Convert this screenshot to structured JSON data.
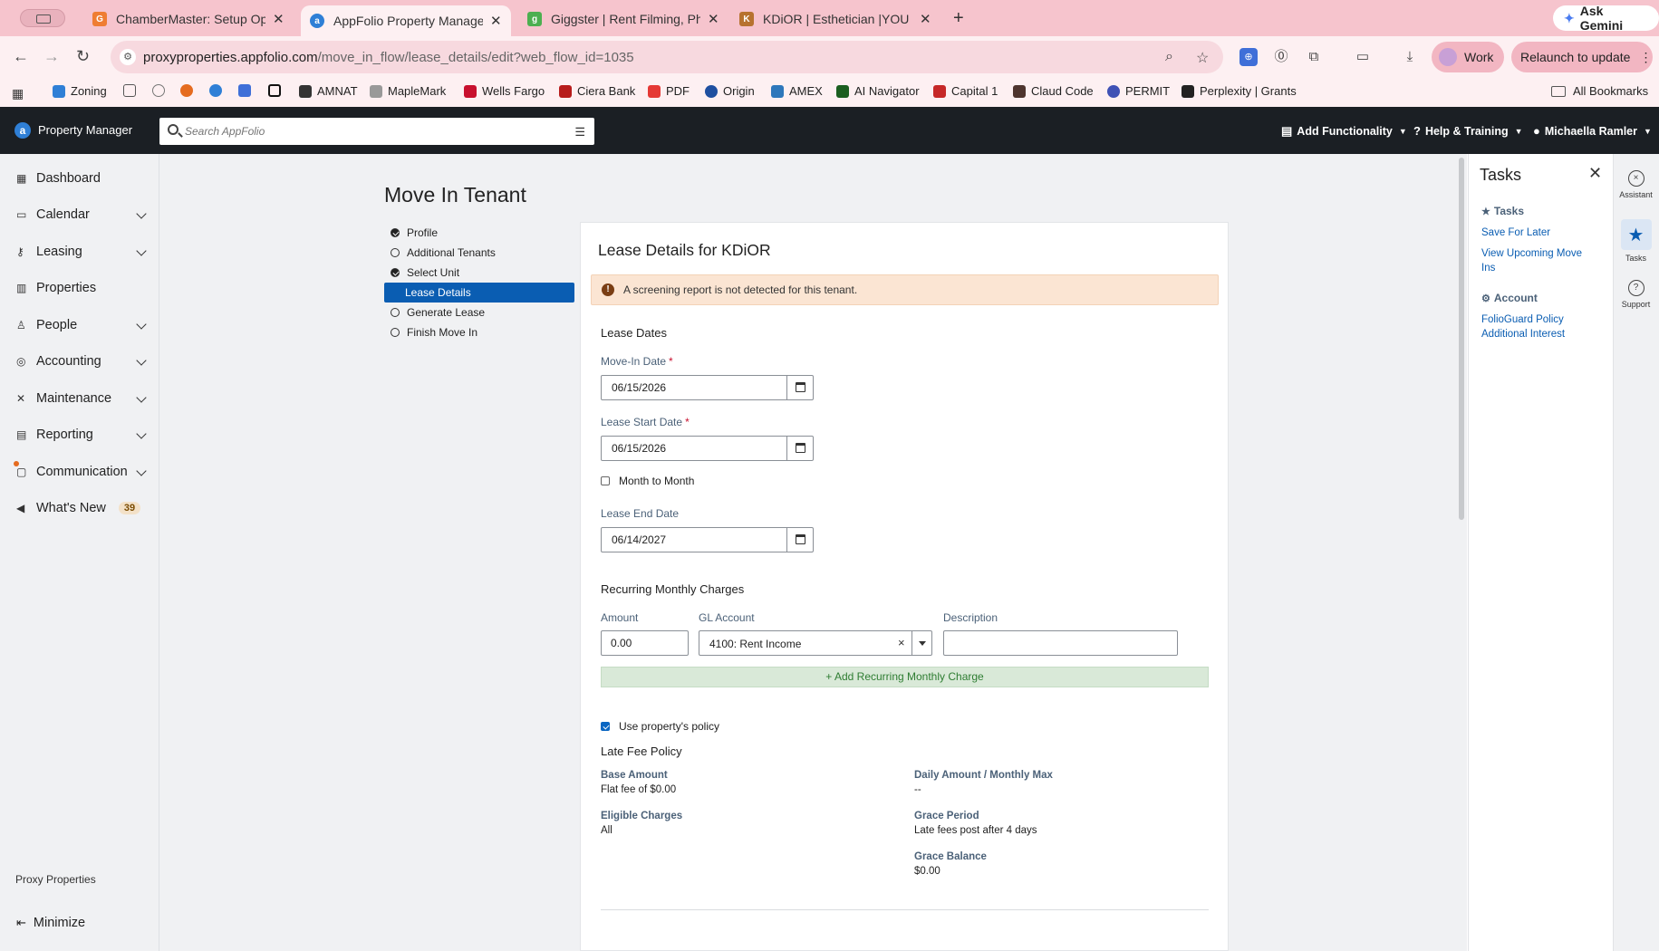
{
  "browser": {
    "tabs": [
      {
        "title": "ChamberMaster: Setup Optio",
        "icon_color": "#ef7d33",
        "icon_letter": "G"
      },
      {
        "title": "AppFolio Property Manager",
        "icon_color": "#2f7fd6",
        "icon_letter": "a"
      },
      {
        "title": "Giggster | Rent Filming, Photo",
        "icon_color": "#4caf50",
        "icon_letter": "g"
      },
      {
        "title": "KDiOR | Esthetician |YOU DE",
        "icon_color": "#b7722f",
        "icon_letter": "K"
      }
    ],
    "gemini_label": "Ask Gemini",
    "url_host": "proxyproperties.appfolio.com",
    "url_path": "/move_in_flow/lease_details/edit?web_flow_id=1035",
    "work_label": "Work",
    "relaunch_label": "Relaunch to update",
    "bookmarks": [
      {
        "label": "Zoning",
        "color": "#2f7fd6"
      },
      {
        "label": "",
        "color": "#555555"
      },
      {
        "label": "",
        "color": "#777777"
      },
      {
        "label": "",
        "color": "#e56b1f"
      },
      {
        "label": "",
        "color": "#2f7fd6"
      },
      {
        "label": "",
        "color": "#3f6fd8"
      },
      {
        "label": "",
        "color": "#111111"
      },
      {
        "label": "AMNAT",
        "color": "#333333"
      },
      {
        "label": "MapleMark",
        "color": "#999999"
      },
      {
        "label": "Wells Fargo",
        "color": "#c8102e"
      },
      {
        "label": "Ciera Bank",
        "color": "#b71c1c"
      },
      {
        "label": "PDF",
        "color": "#e53935"
      },
      {
        "label": "Origin",
        "color": "#1e4fa0"
      },
      {
        "label": "AMEX",
        "color": "#2e77bb"
      },
      {
        "label": "AI Navigator",
        "color": "#1b5e20"
      },
      {
        "label": "Capital 1",
        "color": "#c62828"
      },
      {
        "label": "Claud Code",
        "color": "#4e342e"
      },
      {
        "label": "PERMIT",
        "color": "#3f51b5"
      },
      {
        "label": "Perplexity | Grants",
        "color": "#222222"
      }
    ],
    "all_bookmarks": "All Bookmarks"
  },
  "app": {
    "brand": "Property Manager",
    "search_placeholder": "Search AppFolio",
    "menus": {
      "add_functionality": "Add Functionality",
      "help": "Help & Training",
      "user": "Michaella Ramler"
    }
  },
  "sidebar": {
    "items": [
      {
        "label": "Dashboard",
        "icon": "grid-icon"
      },
      {
        "label": "Calendar",
        "icon": "calendar-icon"
      },
      {
        "label": "Leasing",
        "icon": "key-icon"
      },
      {
        "label": "Properties",
        "icon": "building-icon"
      },
      {
        "label": "People",
        "icon": "person-icon"
      },
      {
        "label": "Accounting",
        "icon": "coin-icon"
      },
      {
        "label": "Maintenance",
        "icon": "wrench-icon"
      },
      {
        "label": "Reporting",
        "icon": "table-icon"
      },
      {
        "label": "Communication",
        "icon": "chat-icon"
      },
      {
        "label": "What's New",
        "icon": "megaphone-icon"
      }
    ],
    "whats_new_count": "39",
    "footer": "Proxy Properties",
    "minimize": "Minimize"
  },
  "page": {
    "title": "Move In Tenant",
    "steps": [
      {
        "label": "Profile",
        "state": "done"
      },
      {
        "label": "Additional Tenants",
        "state": "todo"
      },
      {
        "label": "Select Unit",
        "state": "done"
      },
      {
        "label": "Lease Details",
        "state": "active"
      },
      {
        "label": "Generate Lease",
        "state": "todo"
      },
      {
        "label": "Finish Move In",
        "state": "todo"
      }
    ]
  },
  "lease": {
    "title": "Lease Details for KDiOR",
    "alert": "A screening report is not detected for this tenant.",
    "dates_heading": "Lease Dates",
    "move_in_label": "Move-In Date",
    "move_in_value": "06/15/2026",
    "lease_start_label": "Lease Start Date",
    "lease_start_value": "06/15/2026",
    "month_to_month": "Month to Month",
    "lease_end_label": "Lease End Date",
    "lease_end_value": "06/14/2027",
    "recurring_heading": "Recurring Monthly Charges",
    "amount_label": "Amount",
    "amount_value": "0.00",
    "gl_label": "GL Account",
    "gl_value": "4100: Rent Income",
    "description_label": "Description",
    "description_value": "",
    "add_charge": "+ Add Recurring Monthly Charge",
    "use_policy": "Use property's policy",
    "late_fee_heading": "Late Fee Policy",
    "base_amount_label": "Base Amount",
    "base_amount_value": "Flat fee of $0.00",
    "eligible_label": "Eligible Charges",
    "eligible_value": "All",
    "daily_label": "Daily Amount / Monthly Max",
    "daily_value": "--",
    "grace_period_label": "Grace Period",
    "grace_period_value": "Late fees post after 4 days",
    "grace_balance_label": "Grace Balance",
    "grace_balance_value": "$0.00"
  },
  "tasks": {
    "title": "Tasks",
    "group1": "Tasks",
    "save_later": "Save For Later",
    "view_upcoming": "View Upcoming Move Ins",
    "group2": "Account",
    "folioguard": "FolioGuard Policy Additional Interest"
  },
  "rail": {
    "assistant": "Assistant",
    "tasks": "Tasks",
    "support": "Support"
  }
}
